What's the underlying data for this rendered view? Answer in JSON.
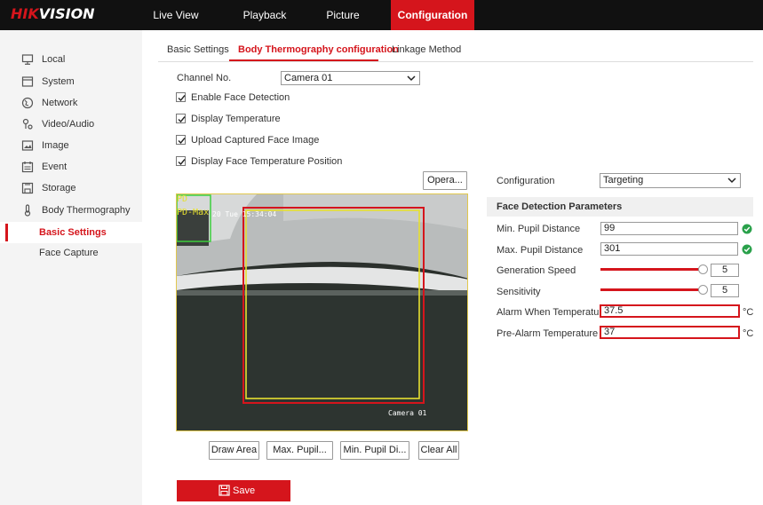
{
  "brand": {
    "logo_red": "HIK",
    "logo_white": "VISION"
  },
  "nav": [
    {
      "label": "Live View",
      "active": false
    },
    {
      "label": "Playback",
      "active": false
    },
    {
      "label": "Picture",
      "active": false
    },
    {
      "label": "Configuration",
      "active": true
    }
  ],
  "sidebar": {
    "items": [
      {
        "label": "Local",
        "icon": "monitor-icon"
      },
      {
        "label": "System",
        "icon": "system-icon"
      },
      {
        "label": "Network",
        "icon": "globe-icon"
      },
      {
        "label": "Video/Audio",
        "icon": "video-audio-icon"
      },
      {
        "label": "Image",
        "icon": "image-icon"
      },
      {
        "label": "Event",
        "icon": "calendar-icon"
      },
      {
        "label": "Storage",
        "icon": "storage-icon"
      },
      {
        "label": "Body Thermography",
        "icon": "thermometer-icon"
      },
      {
        "label": "Basic Settings",
        "active": true
      },
      {
        "label": "Face Capture"
      }
    ]
  },
  "tabs": [
    {
      "label": "Basic Settings",
      "active": false
    },
    {
      "label": "Body Thermography configuration",
      "active": true
    },
    {
      "label": "Linkage Method",
      "active": false
    }
  ],
  "form": {
    "channel_label": "Channel No.",
    "channel_value": "Camera 01",
    "checkboxes": [
      {
        "label": "Enable Face Detection",
        "checked": true
      },
      {
        "label": "Display Temperature",
        "checked": true
      },
      {
        "label": "Upload Captured Face Image",
        "checked": true
      },
      {
        "label": "Display Face Temperature Position",
        "checked": true
      }
    ],
    "opera_button": "Opera..."
  },
  "video": {
    "osd_pd": "PD",
    "osd_pd_max": "PD-Max",
    "osd_datetime": "20 Tue 15:34:04",
    "osd_camera": "Camera 01"
  },
  "video_buttons": {
    "draw_area": "Draw Area",
    "max_pupil": "Max. Pupil...",
    "min_pupil": "Min. Pupil Di...",
    "clear_all": "Clear All"
  },
  "right_panel": {
    "configuration_label": "Configuration",
    "configuration_value": "Targeting",
    "section_title": "Face Detection Parameters",
    "min_pupil_label": "Min. Pupil Distance",
    "min_pupil_value": "99",
    "max_pupil_label": "Max. Pupil Distance",
    "max_pupil_value": "301",
    "generation_speed_label": "Generation Speed",
    "generation_speed_value": "5",
    "sensitivity_label": "Sensitivity",
    "sensitivity_value": "5",
    "alarm_temp_label": "Alarm When Temperatur...",
    "alarm_temp_value": "37.5",
    "prealarm_temp_label": "Pre-Alarm Temperature",
    "prealarm_temp_value": "37",
    "temp_unit": "°C"
  },
  "save_label": "Save",
  "colors": {
    "accent": "#d5151c",
    "topbar": "#111111",
    "ok": "#2aa14b"
  }
}
